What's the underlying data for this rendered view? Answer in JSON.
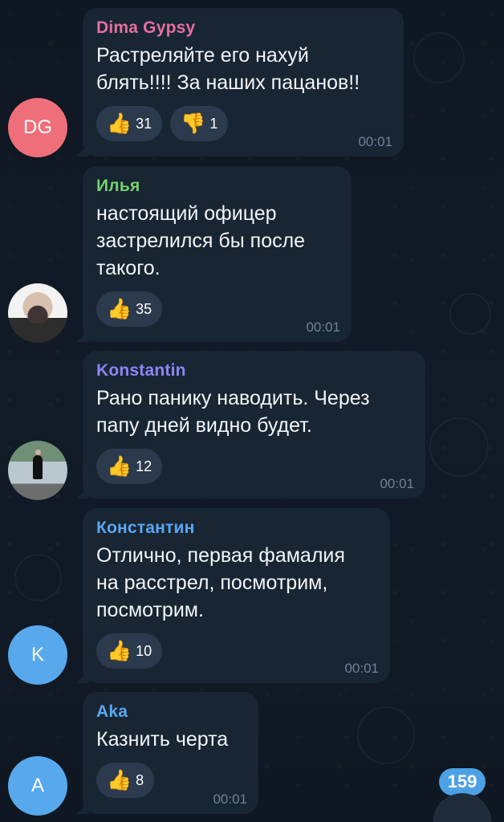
{
  "messages": [
    {
      "sender": "Dima Gypsy",
      "sender_color": "#e66fa0",
      "avatar_text": "DG",
      "avatar_color": "#ee6f7a",
      "text": "Растреляйте его нахуй\nблять!!!! За наших пацанов!!",
      "reactions": [
        {
          "emoji": "👍",
          "count": "31"
        },
        {
          "emoji": "👎",
          "count": "1"
        }
      ],
      "time": "00:01"
    },
    {
      "sender": "Илья",
      "sender_color": "#75d26d",
      "avatar_text": "",
      "avatar_color": "#f1f1f1",
      "text": "настоящий офицер\nзастрелился бы после\nтакого.",
      "reactions": [
        {
          "emoji": "👍",
          "count": "35"
        }
      ],
      "time": "00:01"
    },
    {
      "sender": "Konstantin",
      "sender_color": "#8c85f2",
      "avatar_text": "",
      "avatar_color": "#a7b8bb",
      "text": "Рано панику наводить. Через\nпапу дней видно будет.",
      "reactions": [
        {
          "emoji": "👍",
          "count": "12"
        }
      ],
      "time": "00:01"
    },
    {
      "sender": "Константин",
      "sender_color": "#5aa7f1",
      "avatar_text": "K",
      "avatar_color": "#58a8ec",
      "text": "Отлично, первая фамалия\nна расстрел, посмотрим,\nпосмотрим.",
      "reactions": [
        {
          "emoji": "👍",
          "count": "10"
        }
      ],
      "time": "00:01"
    },
    {
      "sender": "Aka",
      "sender_color": "#58a8ec",
      "avatar_text": "A",
      "avatar_color": "#58a8ec",
      "text": "Казнить черта",
      "reactions": [
        {
          "emoji": "👍",
          "count": "8"
        }
      ],
      "time": "00:01"
    }
  ],
  "unread_count": "159",
  "scroll_icon": "chevron-down-icon",
  "colors": {
    "background": "#0e1621",
    "bubble": "#182533",
    "reaction": "#2b3a4c",
    "time": "#6f8298",
    "badge": "#4ca1e5"
  }
}
